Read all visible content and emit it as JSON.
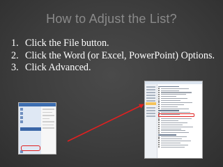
{
  "slide": {
    "title": "How to Adjust the List?",
    "steps": [
      {
        "number": "1.",
        "text": "Click the File button."
      },
      {
        "number": "2.",
        "text": "Click the Word (or Excel, PowerPoint) Options."
      },
      {
        "number": "3.",
        "text": "Click Advanced."
      }
    ]
  },
  "colors": {
    "background": "#3d3d3d",
    "title": "#8a8a8a",
    "body_text": "#ffffff",
    "highlight": "#e02020",
    "arrow": "#e02020"
  },
  "icons": [
    "arrow-right-icon"
  ]
}
